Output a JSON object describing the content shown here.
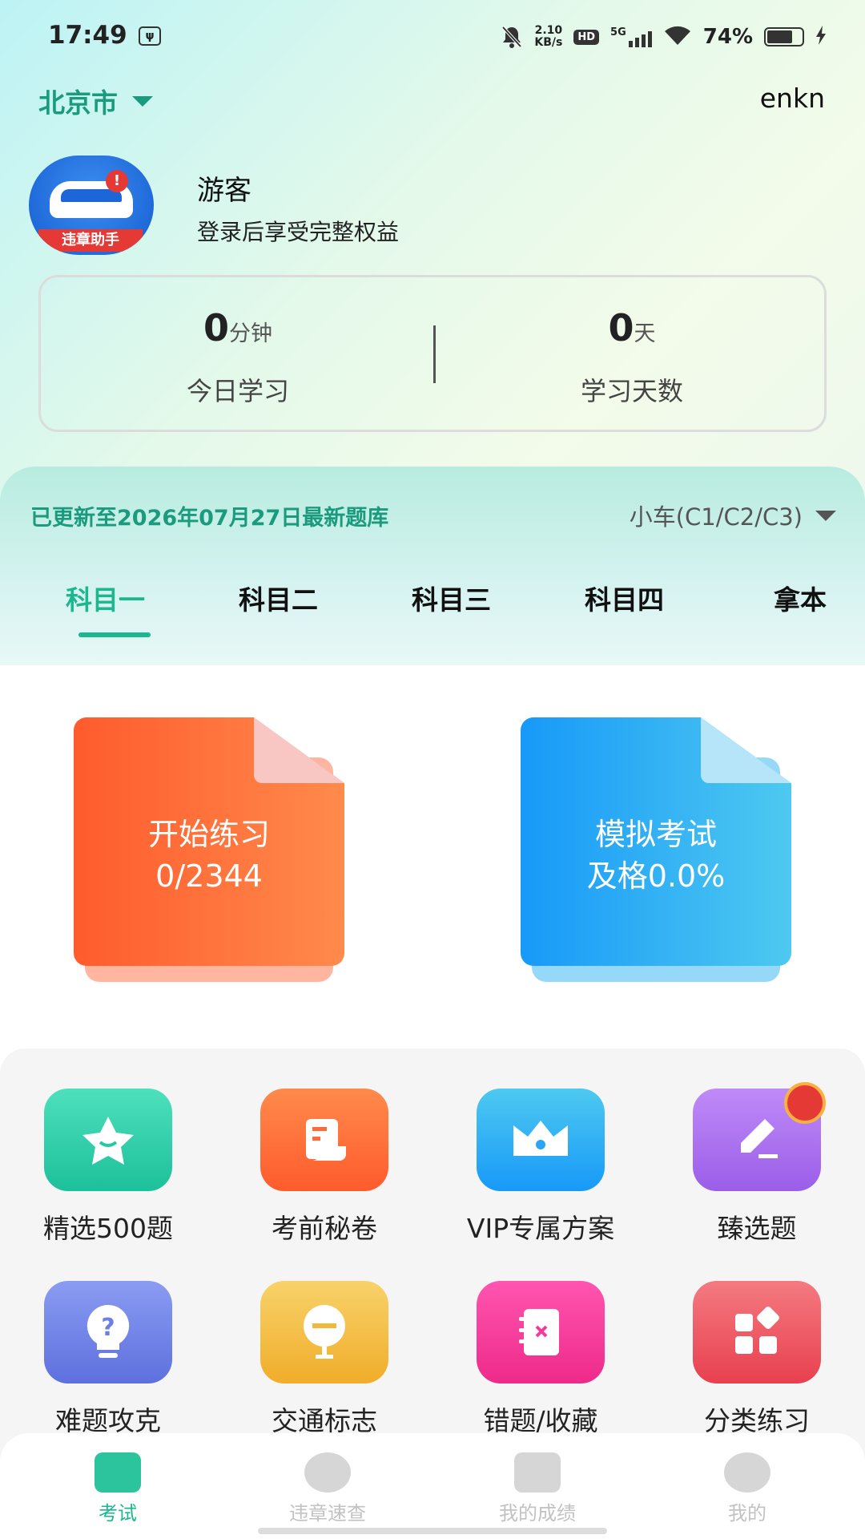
{
  "status_bar": {
    "time": "17:49",
    "net_speed": "2.10",
    "net_unit": "KB/s",
    "hd": "HD",
    "signal": "5G",
    "battery": "74%"
  },
  "header": {
    "city": "北京市",
    "top_right": "enkn"
  },
  "user": {
    "avatar_badge": "违章助手",
    "name": "游客",
    "subtitle": "登录后享受完整权益"
  },
  "stats": {
    "today": {
      "value": "0",
      "unit": "分钟",
      "label": "今日学习"
    },
    "days": {
      "value": "0",
      "unit": "天",
      "label": "学习天数"
    }
  },
  "exam": {
    "update_text": "已更新至2026年07月27日最新题库",
    "car_type": "小车(C1/C2/C3)",
    "tabs": [
      "科目一",
      "科目二",
      "科目三",
      "科目四",
      "拿本"
    ],
    "active_tab": 0
  },
  "cards": {
    "practice": {
      "title": "开始练习",
      "progress": "0/2344"
    },
    "mock": {
      "title": "模拟考试",
      "pass_rate": "及格0.0%"
    }
  },
  "features": [
    {
      "label": "精选500题",
      "icon": "star-icon",
      "color": "#27c9a2"
    },
    {
      "label": "考前秘卷",
      "icon": "scroll-icon",
      "color": "#ff6a3a"
    },
    {
      "label": "VIP专属方案",
      "icon": "crown-icon",
      "color": "#2aa6f4"
    },
    {
      "label": "臻选题",
      "icon": "edit-icon",
      "color": "#a66cf0"
    },
    {
      "label": "难题攻克",
      "icon": "bulb-question-icon",
      "color": "#6b7fe6"
    },
    {
      "label": "交通标志",
      "icon": "road-sign-icon",
      "color": "#f2b83a"
    },
    {
      "label": "错题/收藏",
      "icon": "notebook-icon",
      "color": "#f4399a"
    },
    {
      "label": "分类练习",
      "icon": "category-icon",
      "color": "#ee4f5e"
    }
  ],
  "bottom_nav": [
    {
      "label": "考试",
      "icon": "exam-icon"
    },
    {
      "label": "违章速查",
      "icon": "violation-icon"
    },
    {
      "label": "我的成绩",
      "icon": "score-icon"
    },
    {
      "label": "我的",
      "icon": "profile-icon"
    }
  ],
  "colors": {
    "accent": "#1bb78f",
    "accent_dark": "#1b9b7e",
    "orange": "#ff6a3a",
    "blue": "#1799f8"
  }
}
